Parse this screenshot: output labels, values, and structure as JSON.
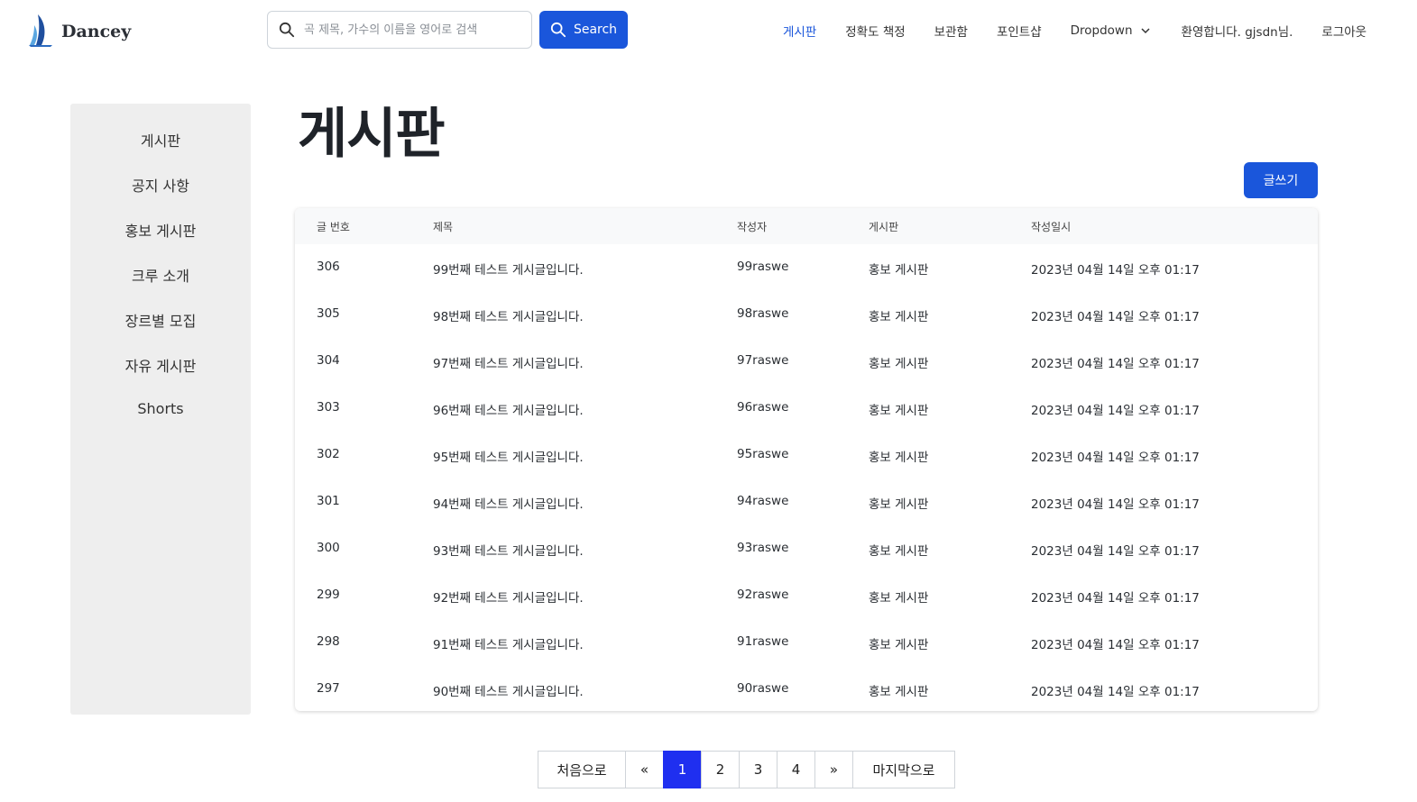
{
  "brand": {
    "name": "Dancey"
  },
  "search": {
    "placeholder": "곡 제목, 가수의 이름을 영어로 검색",
    "button_label": "Search"
  },
  "nav": {
    "items": [
      "게시판",
      "정확도 책정",
      "보관함",
      "포인트샵"
    ],
    "dropdown_label": "Dropdown",
    "welcome": "환영합니다. gjsdn님.",
    "logout": "로그아웃"
  },
  "sidebar": {
    "items": [
      "게시판",
      "공지 사항",
      "홍보 게시판",
      "크루 소개",
      "장르별 모집",
      "자유 게시판",
      "Shorts"
    ]
  },
  "main": {
    "title": "게시판",
    "write_button": "글쓰기"
  },
  "table": {
    "headers": [
      "글 번호",
      "제목",
      "작성자",
      "게시판",
      "작성일시"
    ],
    "rows": [
      [
        "306",
        "99번째 테스트 게시글입니다.",
        "99raswe",
        "홍보 게시판",
        "2023년 04월 14일 오후 01:17"
      ],
      [
        "305",
        "98번째 테스트 게시글입니다.",
        "98raswe",
        "홍보 게시판",
        "2023년 04월 14일 오후 01:17"
      ],
      [
        "304",
        "97번째 테스트 게시글입니다.",
        "97raswe",
        "홍보 게시판",
        "2023년 04월 14일 오후 01:17"
      ],
      [
        "303",
        "96번째 테스트 게시글입니다.",
        "96raswe",
        "홍보 게시판",
        "2023년 04월 14일 오후 01:17"
      ],
      [
        "302",
        "95번째 테스트 게시글입니다.",
        "95raswe",
        "홍보 게시판",
        "2023년 04월 14일 오후 01:17"
      ],
      [
        "301",
        "94번째 테스트 게시글입니다.",
        "94raswe",
        "홍보 게시판",
        "2023년 04월 14일 오후 01:17"
      ],
      [
        "300",
        "93번째 테스트 게시글입니다.",
        "93raswe",
        "홍보 게시판",
        "2023년 04월 14일 오후 01:17"
      ],
      [
        "299",
        "92번째 테스트 게시글입니다.",
        "92raswe",
        "홍보 게시판",
        "2023년 04월 14일 오후 01:17"
      ],
      [
        "298",
        "91번째 테스트 게시글입니다.",
        "91raswe",
        "홍보 게시판",
        "2023년 04월 14일 오후 01:17"
      ],
      [
        "297",
        "90번째 테스트 게시글입니다.",
        "90raswe",
        "홍보 게시판",
        "2023년 04월 14일 오후 01:17"
      ]
    ]
  },
  "pagination": {
    "first": "처음으로",
    "prev": "«",
    "pages": [
      "1",
      "2",
      "3",
      "4"
    ],
    "current": "1",
    "next": "»",
    "last": "마지막으로"
  },
  "colors": {
    "accent": "#1a56db",
    "active_page": "#1f2ff0",
    "sidebar_bg": "#eeeeee"
  },
  "icons": {
    "search": "search-icon",
    "dropdown": "chevron-down-icon",
    "logo": "sail-logo-icon"
  }
}
